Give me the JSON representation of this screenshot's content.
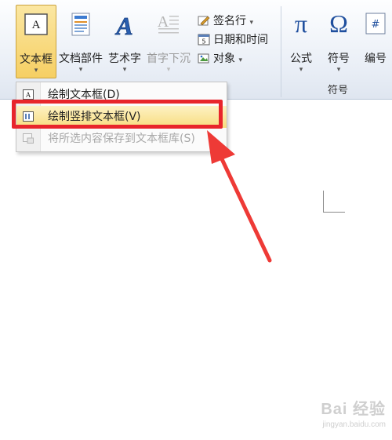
{
  "ribbon": {
    "text_group": {
      "textbox": "文本框",
      "quickparts": "文档部件",
      "wordart": "艺术字",
      "dropcap": "首字下沉",
      "signature_line": "签名行",
      "datetime": "日期和时间",
      "object": "对象"
    },
    "symbols_group": {
      "equation": "公式",
      "symbol": "符号",
      "number": "编号",
      "group_label": "符号",
      "pi_glyph": "π",
      "omega_glyph": "Ω"
    },
    "dropdown_arrow": "▾"
  },
  "menu": {
    "items": [
      {
        "label": "绘制文本框(D)",
        "icon": "textbox-horizontal-icon",
        "state": "normal"
      },
      {
        "label": "绘制竖排文本框(V)",
        "icon": "textbox-vertical-icon",
        "state": "highlighted"
      },
      {
        "label": "将所选内容保存到文本框库(S)",
        "icon": "save-to-gallery-icon",
        "state": "disabled"
      }
    ]
  },
  "annotation": {
    "highlight_color": "#e8252b"
  },
  "watermark": {
    "brand": "Bai 经验",
    "url": "jingyan.baidu.com"
  },
  "colors": {
    "active_button": "#f6cf63",
    "menu_highlight": "#f8dd7f",
    "ribbon_bg": "#e9eef6"
  }
}
